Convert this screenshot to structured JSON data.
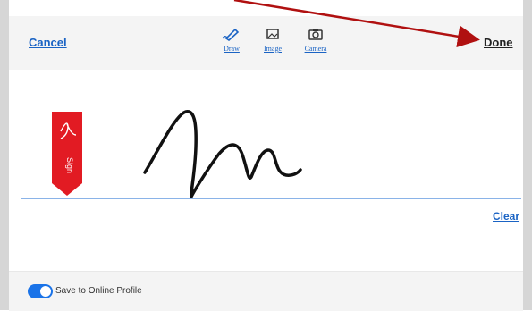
{
  "header": {
    "cancel_label": "Cancel",
    "done_label": "Done",
    "modes": [
      {
        "label": "Draw",
        "icon": "pen-icon"
      },
      {
        "label": "Image",
        "icon": "image-icon"
      },
      {
        "label": "Camera",
        "icon": "camera-icon"
      }
    ]
  },
  "signature_area": {
    "badge_text": "Sign",
    "badge_color": "#e21b23",
    "clear_label": "Clear"
  },
  "footer": {
    "toggle_on": true,
    "toggle_label": "Save to Online Profile"
  },
  "annotation": {
    "arrow_color": "#b01010"
  },
  "colors": {
    "accent": "#1a73e8",
    "link": "#1a63c4"
  }
}
